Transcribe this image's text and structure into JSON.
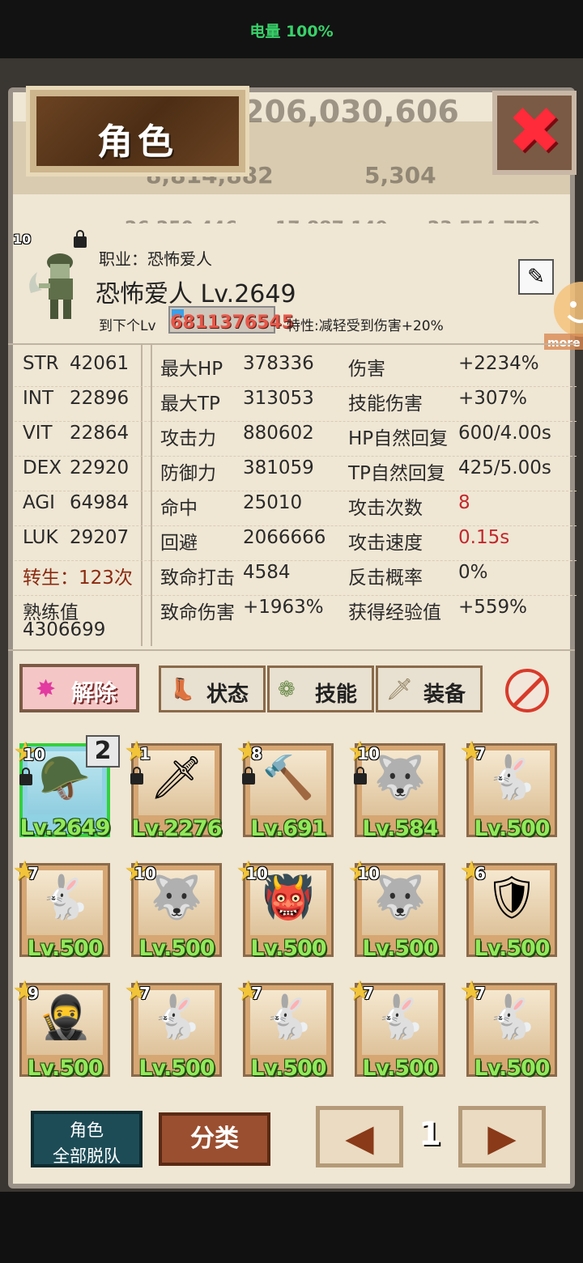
{
  "status": {
    "battery": "电量 100%"
  },
  "background": {
    "numbers": [
      "206,030,606",
      "8,814,882",
      "5,304",
      "26,250,446",
      "17,887,149",
      "23,554,778"
    ]
  },
  "title": "角色",
  "hero": {
    "star": "10",
    "job": "职业：恐怖爱人",
    "name": "恐怖爱人 Lv.2649",
    "exp_label": "到下个Lv",
    "exp_value": "6811376545",
    "exp_progress": 0.12,
    "trait": "特性:减轻受到伤害+20%"
  },
  "stats": [
    [
      "STR",
      "42061",
      "最大HP",
      "378336",
      "伤害",
      "+2234%"
    ],
    [
      "INT",
      "22896",
      "最大TP",
      "313053",
      "技能伤害",
      "+307%"
    ],
    [
      "VIT",
      "22864",
      "攻击力",
      "880602",
      "HP自然回复",
      "600/4.00s"
    ],
    [
      "DEX",
      "22920",
      "防御力",
      "381059",
      "TP自然回复",
      "425/5.00s"
    ],
    [
      "AGI",
      "64984",
      "命中",
      "25010",
      "攻击次数",
      "8"
    ],
    [
      "LUK",
      "29207",
      "回避",
      "2066666",
      "攻击速度",
      "0.15s"
    ],
    [
      "转生：123次",
      "",
      "致命打击",
      "4584",
      "反击概率",
      "0%"
    ]
  ],
  "proficiency": {
    "label": "熟练值",
    "value": "4306699"
  },
  "crit_damage": {
    "label": "致命伤害",
    "value": "+1963%"
  },
  "exp_gain": {
    "label": "获得经验值",
    "value": "+559%"
  },
  "tabs": {
    "release": "解除",
    "status": "状态",
    "skill": "技能",
    "equip": "装备"
  },
  "team_badge": "2",
  "cards": [
    {
      "star": "10",
      "lv": "Lv.2649",
      "icon": "soldier-ghost-icon",
      "locked": true,
      "selected": true
    },
    {
      "star": "1",
      "lv": "Lv.2276",
      "icon": "swordsman-icon",
      "locked": true
    },
    {
      "star": "8",
      "lv": "Lv.691",
      "icon": "hammer-girl-icon",
      "locked": true
    },
    {
      "star": "10",
      "lv": "Lv.584",
      "icon": "beast-icon",
      "locked": true
    },
    {
      "star": "7",
      "lv": "Lv.500",
      "icon": "rabbit-icon"
    },
    {
      "star": "7",
      "lv": "Lv.500",
      "icon": "rabbit-icon"
    },
    {
      "star": "10",
      "lv": "Lv.500",
      "icon": "beast-icon"
    },
    {
      "star": "10",
      "lv": "Lv.500",
      "icon": "ogre-icon"
    },
    {
      "star": "10",
      "lv": "Lv.500",
      "icon": "beast-icon"
    },
    {
      "star": "6",
      "lv": "Lv.500",
      "icon": "knight-icon"
    },
    {
      "star": "9",
      "lv": "Lv.500",
      "icon": "ninja-icon"
    },
    {
      "star": "7",
      "lv": "Lv.500",
      "icon": "rabbit-icon"
    },
    {
      "star": "7",
      "lv": "Lv.500",
      "icon": "rabbit-icon"
    },
    {
      "star": "7",
      "lv": "Lv.500",
      "icon": "rabbit-icon"
    },
    {
      "star": "7",
      "lv": "Lv.500",
      "icon": "rabbit-icon"
    }
  ],
  "bottom": {
    "leave_line1": "角色",
    "leave_line2": "全部脱队",
    "sort": "分类",
    "page": "1"
  },
  "colors": {
    "level_text": "#92e85a",
    "accent_red": "#c0282e",
    "panel_bg": "#efe6d4"
  }
}
